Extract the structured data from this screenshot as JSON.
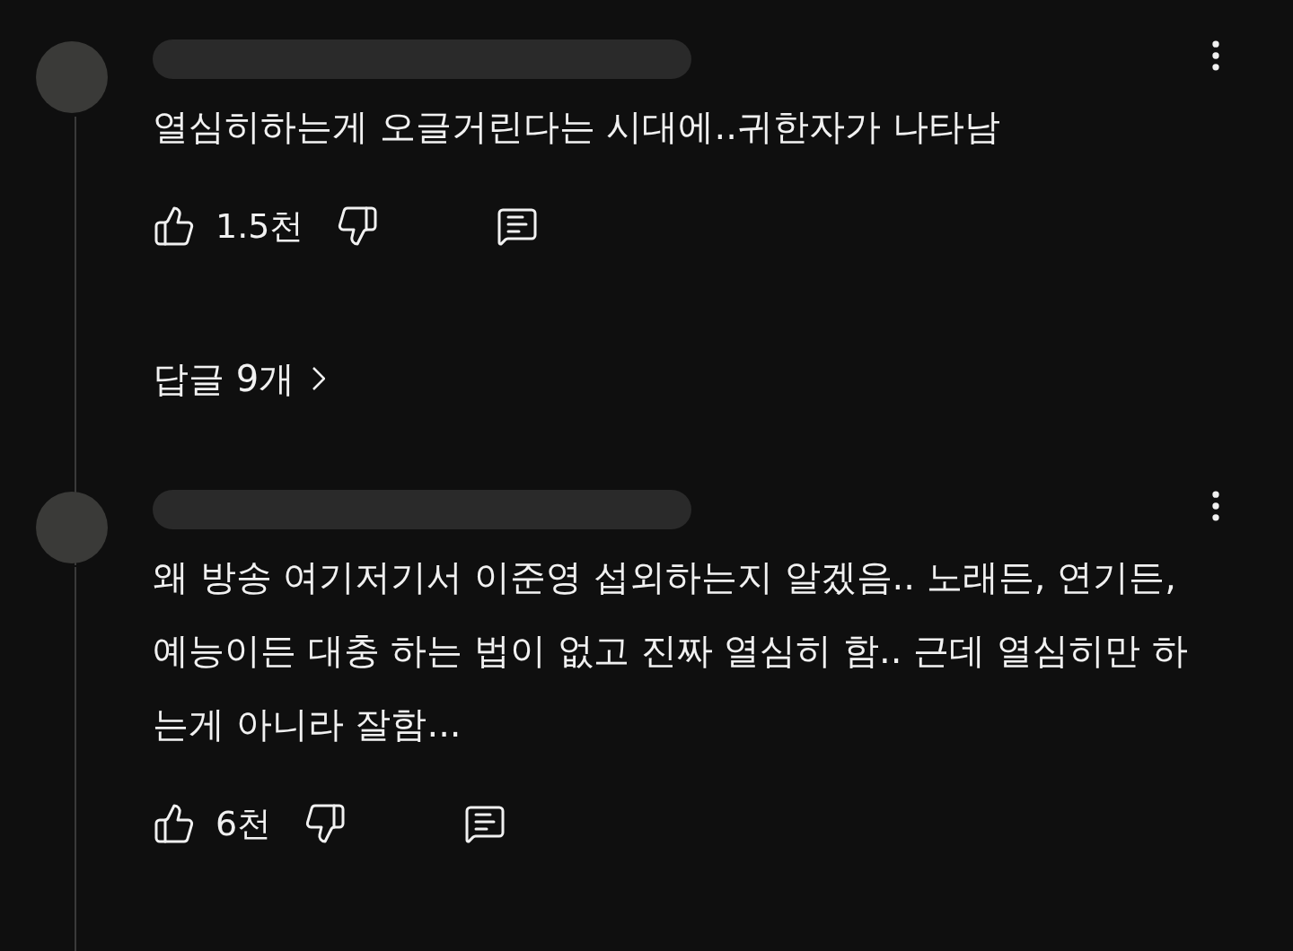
{
  "comments": [
    {
      "text": "열심히하는게 오글거린다는 시대에..귀한자가 나타남",
      "likes": "1.5천",
      "replies": "답글 9개"
    },
    {
      "text": "왜 방송 여기저기서 이준영 섭외하는지 알겠음.. 노래든, 연기든, 예능이든 대충 하는 법이 없고 진짜 열심히 함.. 근데 열심히만 하는게 아니라 잘함...",
      "likes": "6천"
    }
  ]
}
